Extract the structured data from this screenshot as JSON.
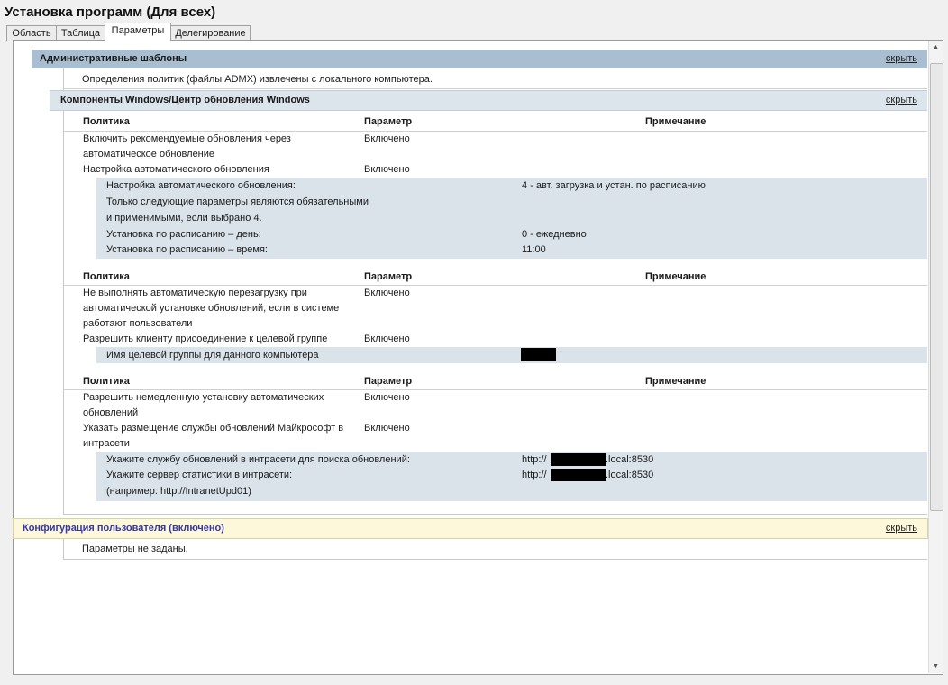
{
  "title": "Установка программ (Для всех)",
  "tabs": [
    "Область",
    "Таблица",
    "Параметры",
    "Делегирование"
  ],
  "hide_label": "скрыть",
  "admin": {
    "header": "Административные шаблоны",
    "note": "Определения политик (файлы ADMX) извлечены с локального компьютера."
  },
  "wu": {
    "header": "Компоненты Windows/Центр обновления Windows"
  },
  "cols": {
    "policy": "Политика",
    "param": "Параметр",
    "note": "Примечание"
  },
  "t1": {
    "r1a": "Включить рекомендуемые обновления через",
    "r1b": "автоматическое обновление",
    "r1v": "Включено",
    "r2": "Настройка автоматического обновления",
    "r2v": "Включено",
    "s1": "Настройка автоматического обновления:",
    "s1v": "4 - авт. загрузка и устан. по расписанию",
    "s2a": "Только следующие параметры являются обязательными",
    "s2b": "и применимыми, если выбрано 4.",
    "s3": "Установка по расписанию – день:",
    "s3v": "0 - ежедневно",
    "s4": "Установка по расписанию – время:",
    "s4v": "11:00"
  },
  "t2": {
    "r1a": "Не выполнять автоматическую перезагрузку при",
    "r1b": "автоматической установке обновлений, если в системе",
    "r1c": "работают пользователи",
    "r1v": "Включено",
    "r2": "Разрешить клиенту присоединение к целевой группе",
    "r2v": "Включено",
    "s1": "Имя целевой группы для данного компьютера"
  },
  "t3": {
    "r1a": "Разрешить немедленную установку автоматических",
    "r1b": "обновлений",
    "r1v": "Включено",
    "r2a": "Указать размещение службы обновлений Майкрософт в",
    "r2b": "интрасети",
    "r2v": "Включено",
    "s1": "Укажите службу обновлений в интрасети для поиска обновлений:",
    "s1v_pre": "http://",
    "s1v_post": ".local:8530",
    "s2": "Укажите сервер статистики в интрасети:",
    "s2v_pre": "http://",
    "s2v_post": ".local:8530",
    "s3": "(например: http://IntranetUpd01)"
  },
  "user": {
    "header": "Конфигурация пользователя (включено)",
    "note": "Параметры не заданы."
  }
}
